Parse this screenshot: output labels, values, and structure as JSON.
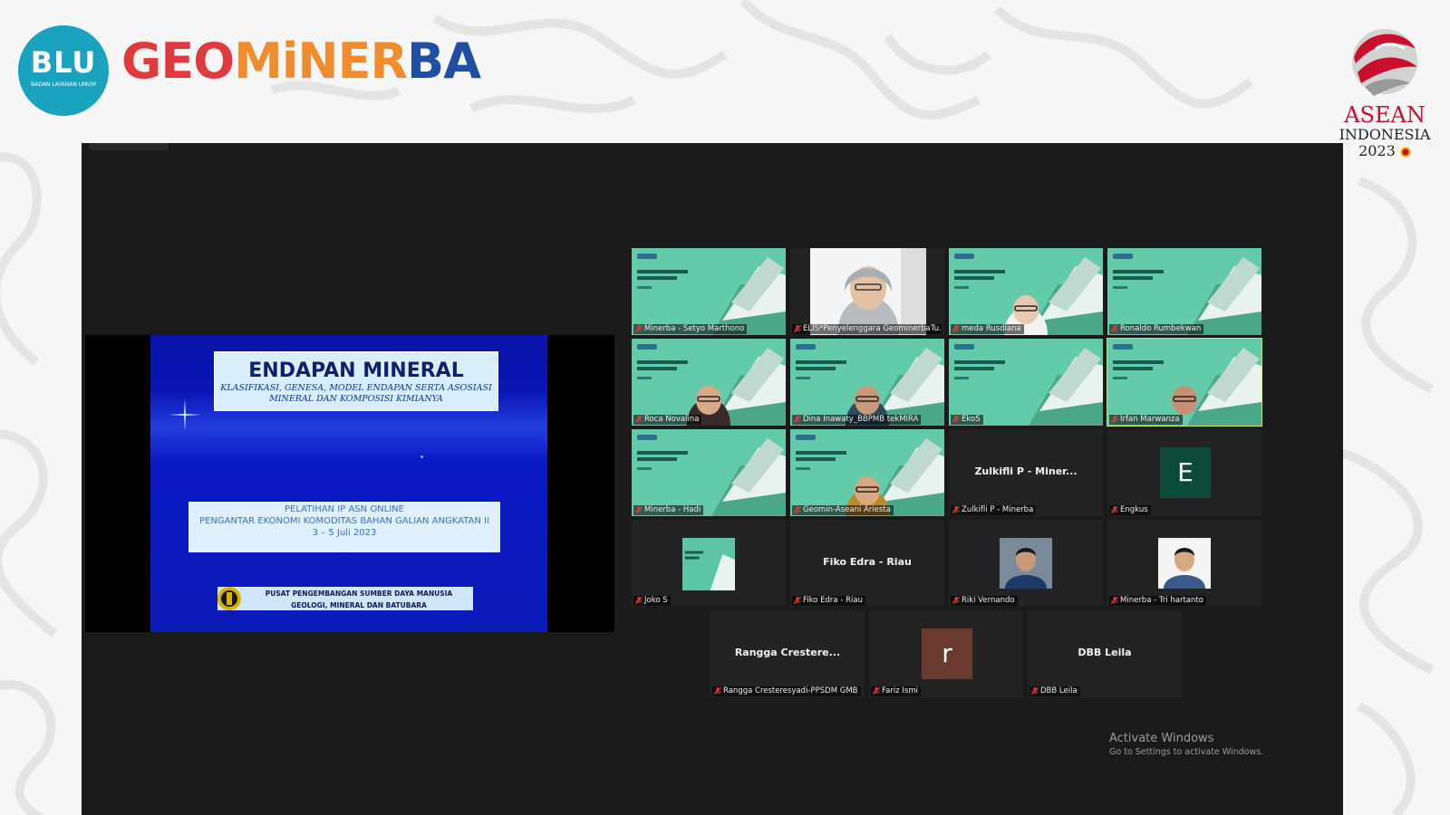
{
  "header": {
    "blu_logo_main": "BLU",
    "blu_logo_sub": "BADAN LAYANAN UMUM",
    "brand_part1": "GEO",
    "brand_part2": "MiNER",
    "brand_part3": "BA",
    "asean_line1": "ASEAN",
    "asean_line2": "INDONESIA",
    "asean_line3": "2023"
  },
  "slide": {
    "title": "ENDAPAN MINERAL",
    "subtitle_line1": "KLASIFIKASI, GENESA, MODEL ENDAPAN SERTA ASOSIASI",
    "subtitle_line2": "MINERAL DAN KOMPOSISI KIMIANYA",
    "event_line1": "PELATIHAN IP ASN ONLINE",
    "event_line2": "PENGANTAR EKONOMI KOMODITAS BAHAN GALIAN ANGKATAN II",
    "event_line3": "3 – 5 Juli 2023",
    "org_line1": "PUSAT PENGEMBANGAN SUMBER DAYA MANUSIA",
    "org_line2": "GEOLOGI, MINERAL DAN BATUBARA"
  },
  "participants": [
    {
      "name": "Minerba - Setyo Marthono",
      "type": "slide"
    },
    {
      "name": "ELIS*Penyelenggara GeominerbaTu...",
      "type": "video"
    },
    {
      "name": "meda Rusdiana",
      "type": "slide-face"
    },
    {
      "name": "Ronaldo Rumbekwan",
      "type": "slide"
    },
    {
      "name": "Roca Novalina",
      "type": "slide-face"
    },
    {
      "name": "Dina Inawaty_BBPMB tekMIRA",
      "type": "slide-face"
    },
    {
      "name": "EkoS",
      "type": "slide"
    },
    {
      "name": "Irfan Marwanza",
      "type": "slide-face",
      "active": true
    },
    {
      "name": "Minerba - Hadi",
      "type": "slide"
    },
    {
      "name": "Geomin-Aseani Ariesta",
      "type": "slide-face"
    },
    {
      "name": "Zulkifli P - Minerba",
      "type": "name",
      "display": "Zulkifli P - Miner..."
    },
    {
      "name": "Engkus",
      "type": "avatar",
      "initial": "E",
      "color": "#0e4a3a"
    },
    {
      "name": "Joko S",
      "type": "small-slide"
    },
    {
      "name": "Fiko Edra - Riau",
      "type": "name",
      "display": "Fiko Edra - Riau"
    },
    {
      "name": "Riki Vernando",
      "type": "photo"
    },
    {
      "name": "Minerba - Tri hartanto",
      "type": "photo"
    },
    {
      "name": "Rangga Cresteresyadi-PPSDM GMB",
      "type": "name",
      "display": "Rangga Crestere..."
    },
    {
      "name": "Fariz Ismi",
      "type": "avatar",
      "initial": "r",
      "color": "#6a3a2e"
    },
    {
      "name": "DBB Leila",
      "type": "name",
      "display": "DBB Leila"
    }
  ],
  "watermark": {
    "line1": "Activate Windows",
    "line2": "Go to Settings to activate Windows."
  },
  "colors": {
    "brand_red": "#e03a3e",
    "brand_orange": "#f08c2e",
    "brand_blue": "#1e4fa3",
    "blu_teal": "#1aa3bf",
    "active_speaker": "#c9e84a"
  }
}
